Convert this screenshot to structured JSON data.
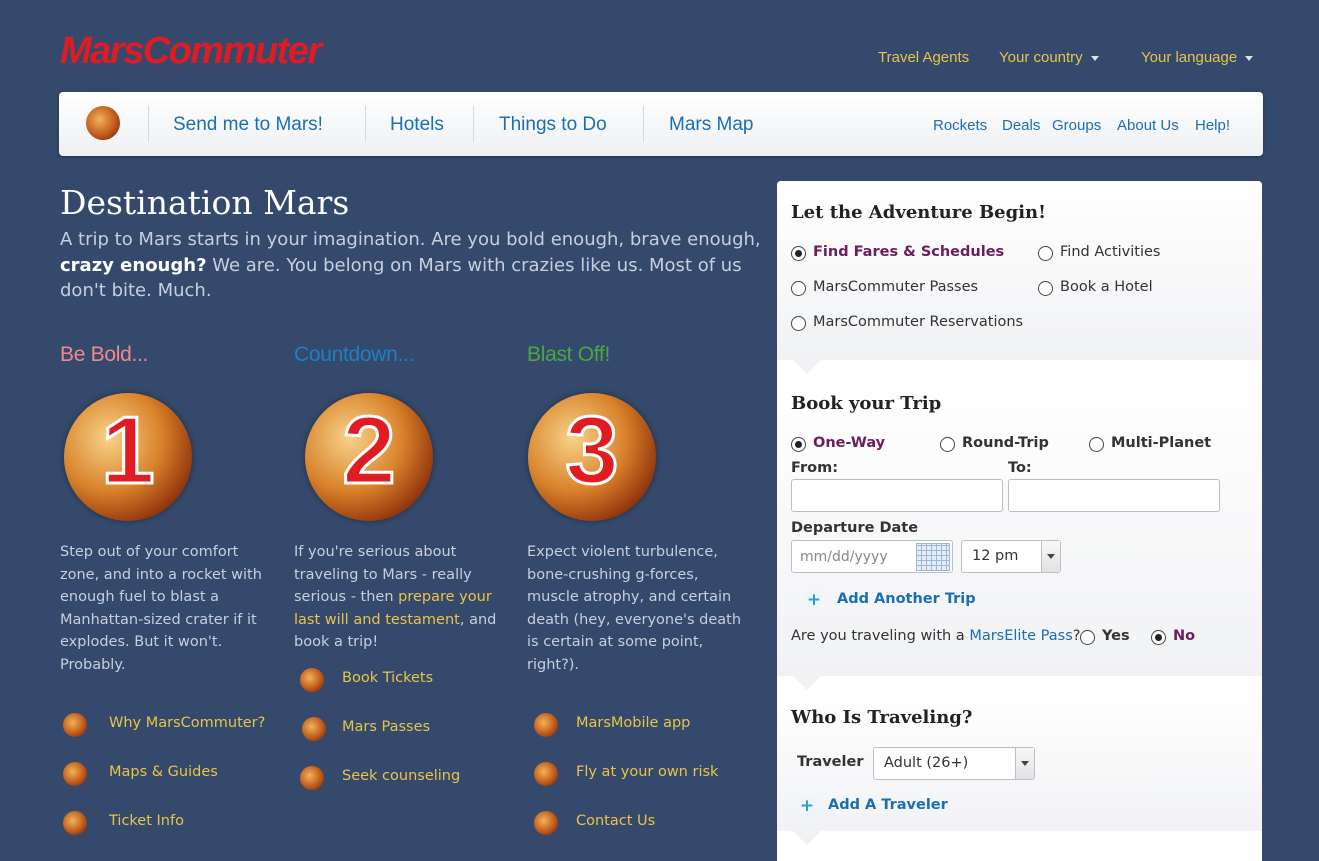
{
  "logo": "MarsCommuter",
  "top_links": {
    "travel_agents": "Travel Agents",
    "country": "Your country",
    "language": "Your language"
  },
  "nav": {
    "main": [
      "Send me to Mars!",
      "Hotels",
      "Things to Do",
      "Mars Map"
    ],
    "secondary": [
      "Rockets",
      "Deals",
      "Groups",
      "About Us",
      "Help!"
    ]
  },
  "hero": {
    "title": "Destination Mars",
    "text_before": "A trip to Mars starts in your imagination. Are you bold enough, brave enough, ",
    "text_bold": "crazy enough?",
    "text_after": " We are. You belong on Mars with crazies like us. Most of us don't bite. Much."
  },
  "steps": [
    {
      "title": "Be Bold...",
      "color": "#f08a8a",
      "number": "1",
      "text": "Step out of your comfort zone, and into a rocket with enough fuel to blast a Manhattan-sized crater if it explodes. But it won't. Probably.",
      "links": [
        "Why MarsCommuter?",
        "Maps & Guides",
        "Ticket Info"
      ]
    },
    {
      "title": "Countdown...",
      "color": "#1f7fc4",
      "number": "2",
      "text_before": "If you're serious about traveling to Mars - really serious - then ",
      "text_link": "prepare your last will and testament",
      "text_after": ", and book a trip!",
      "links": [
        "Book Tickets",
        "Mars Passes",
        "Seek counseling"
      ]
    },
    {
      "title": "Blast Off!",
      "color": "#4aa840",
      "number": "3",
      "text": "Expect violent turbulence, bone-crushing g-forces, muscle atrophy, and certain death (hey, everyone's death is certain at some point, right?).",
      "links": [
        "MarsMobile app",
        "Fly at your own risk",
        "Contact Us"
      ]
    }
  ],
  "panel": {
    "adventure": {
      "title": "Let the Adventure Begin!",
      "options": [
        "Find Fares & Schedules",
        "Find Activities",
        "MarsCommuter Passes",
        "Book a Hotel",
        "MarsCommuter Reservations"
      ],
      "selected": "Find Fares & Schedules"
    },
    "book": {
      "title": "Book your Trip",
      "trip_types": [
        "One-Way",
        "Round-Trip",
        "Multi-Planet"
      ],
      "selected": "One-Way",
      "from_label": "From:",
      "to_label": "To:",
      "from_value": "",
      "to_value": "",
      "date_label": "Departure Date",
      "date_placeholder": "mm/dd/yyyy",
      "time_value": "12 pm",
      "add_trip": "Add Another Trip",
      "elite_question_before": "Are you traveling with a ",
      "elite_link": "MarsElite Pass",
      "elite_question_after": "?",
      "elite_yes": "Yes",
      "elite_no": "No",
      "elite_selected": "No"
    },
    "who": {
      "title": "Who Is Traveling?",
      "traveler_label": "Traveler",
      "traveler_value": "Adult (26+)",
      "add_traveler": "Add A Traveler"
    }
  }
}
